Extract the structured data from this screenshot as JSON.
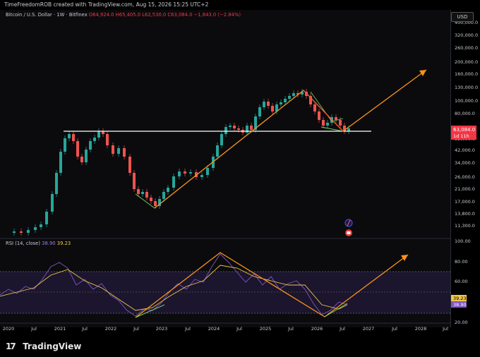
{
  "header": {
    "author_line": "TimeFreedomROB created with TradingView.com, Aug 15, 2026 15:25 UTC+2"
  },
  "legend": {
    "symbol": "Bitcoin / U.S. Dollar · 1W · Bitfinex",
    "ohlc": "O64,924.0 H65,405.0 L62,530.0 C63,084.0 −1,843.0 (−2.84%)"
  },
  "currency_button": "USD",
  "price_axis": {
    "ticks": [
      "400,000.0",
      "320,000.0",
      "260,000.0",
      "200,000.0",
      "160,000.0",
      "130,000.0",
      "100,000.0",
      "80,000.0",
      "63,084.0",
      "52,000.0",
      "42,000.0",
      "34,000.0",
      "26,000.0",
      "21,000.0",
      "17,000.0",
      "13,800.0",
      "11,300.0"
    ],
    "last_price": "63,084.0",
    "countdown": "1d 11h",
    "last_price_color": "#f23645"
  },
  "rsi": {
    "label": "RSI (14, close)",
    "value1": "38.90",
    "value2": "39.23",
    "ticks": [
      "100.00",
      "80.00",
      "60.00",
      "40.00",
      "20.00"
    ],
    "badge_upper": "39.23",
    "badge_lower": "38.90",
    "rsi_color": "#7e57c2",
    "ma_color": "#f0c64a"
  },
  "time_axis": {
    "labels": [
      "2020",
      "Jul",
      "2021",
      "Jul",
      "2022",
      "Jul",
      "2023",
      "Jul",
      "2024",
      "Jul",
      "2025",
      "Jul",
      "2026",
      "Jul",
      "2027",
      "Jul",
      "2028",
      "Jul"
    ]
  },
  "brand": {
    "name": "TradingView",
    "logo_text": "17"
  },
  "colors": {
    "up": "#26a69a",
    "down": "#ef5350",
    "trendline": "#f7931a",
    "support": "#ffffff",
    "divergence": "#6fce61"
  },
  "event_icons": [
    "halving-event-icon",
    "flag-event-icon"
  ]
}
